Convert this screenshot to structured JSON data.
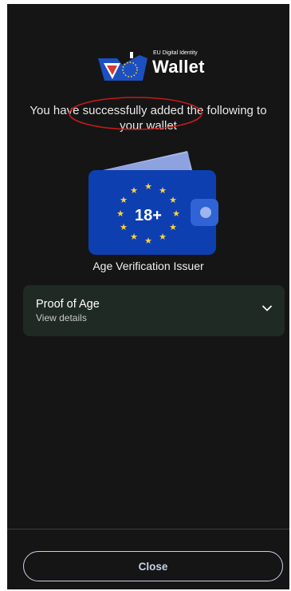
{
  "logo": {
    "small_text": "EU Digital Identity",
    "big_text": "Wallet"
  },
  "message": {
    "line1": "You have successfully added the following to",
    "line2": "your wallet"
  },
  "card": {
    "badge": "18+"
  },
  "issuer": "Age Verification Issuer",
  "document": {
    "title": "Proof of Age",
    "subtitle": "View details"
  },
  "footer": {
    "close_label": "Close"
  },
  "colors": {
    "background": "#151515",
    "card_blue": "#0d3fb0",
    "doc_card_bg": "#1f2a24",
    "button_border": "#c6d1e8",
    "highlight_red": "#c41a1a"
  },
  "icons": {
    "logo": "eu-wallet-logo-icon",
    "card": "age-wallet-card-icon",
    "expand": "chevron-down-icon"
  }
}
